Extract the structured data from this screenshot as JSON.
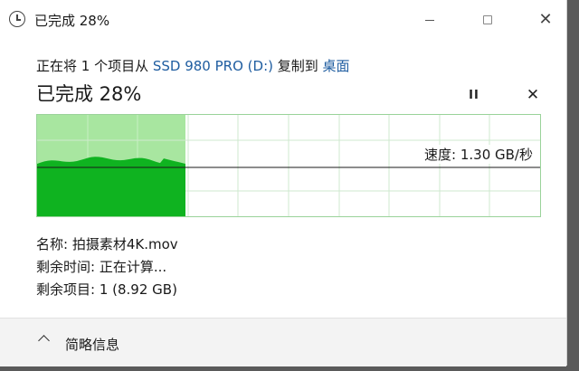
{
  "window": {
    "title": "已完成 28%",
    "controls": {
      "minimize_icon": "minimize-icon",
      "maximize_icon": "maximize-icon",
      "close_icon": "close-icon"
    }
  },
  "transfer": {
    "prefix": "正在将 1 个项目从 ",
    "source": "SSD 980 PRO (D:)",
    "middle": " 复制到 ",
    "destination": "桌面",
    "status": "已完成 28%",
    "pause_icon": "pause-icon",
    "cancel_icon": "cancel-icon",
    "pause_label": "II",
    "cancel_label": "✕"
  },
  "graph": {
    "speed_text": "速度: 1.30 GB/秒",
    "progress": 0.28,
    "colors": {
      "fill_light": "#a8e6a0",
      "fill_dark": "#0fb320",
      "grid": "#cfe9cf",
      "border": "#9ad39a"
    }
  },
  "details": {
    "name": "名称: 拍摄素材4K.mov",
    "time_remaining": "剩余时间: 正在计算...",
    "items_remaining": "剩余项目: 1 (8.92 GB)"
  },
  "footer": {
    "label": "简略信息",
    "icon": "chevron-up-icon"
  }
}
